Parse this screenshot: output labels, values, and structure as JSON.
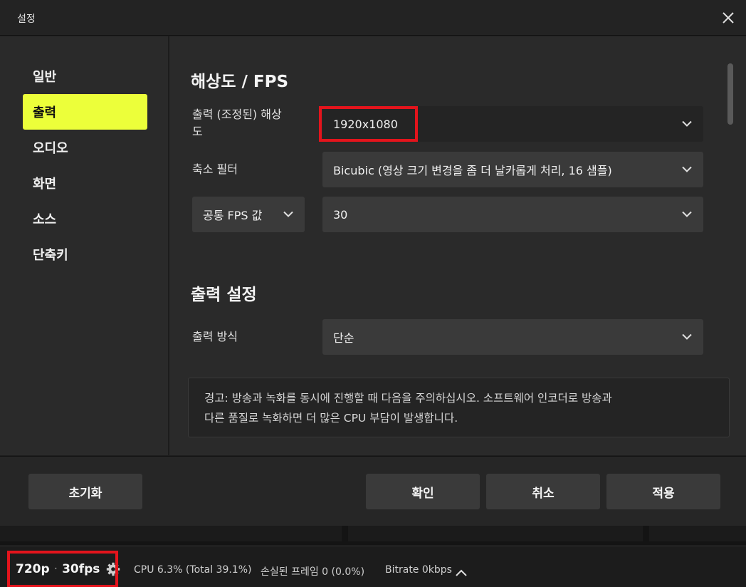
{
  "window": {
    "title": "설정"
  },
  "sidebar": {
    "items": [
      {
        "label": "일반",
        "active": false
      },
      {
        "label": "출력",
        "active": true
      },
      {
        "label": "오디오",
        "active": false
      },
      {
        "label": "화면",
        "active": false
      },
      {
        "label": "소스",
        "active": false
      },
      {
        "label": "단축키",
        "active": false
      }
    ]
  },
  "video": {
    "title": "해상도 / FPS",
    "resolution_label_line1": "출력 (조정된) 해상",
    "resolution_label_line2": "도",
    "resolution_value": "1920x1080",
    "filter_label": "축소 필터",
    "filter_value": "Bicubic (영상 크기 변경을 좀 더 날카롭게 처리, 16 샘플)",
    "fps_type": "공통 FPS 값",
    "fps_value": "30"
  },
  "output": {
    "title": "출력 설정",
    "mode_label": "출력 방식",
    "mode_value": "단순",
    "warning_line1": "경고: 방송과 녹화를 동시에 진행할 때 다음을 주의하십시오. 소프트웨어 인코더로 방송과",
    "warning_line2": "다른 품질로 녹화하면 더 많은 CPU 부담이 발생합니다."
  },
  "buttons": {
    "reset": "초기화",
    "ok": "확인",
    "cancel": "취소",
    "apply": "적용"
  },
  "status": {
    "resolution": "720p",
    "fps": "30fps",
    "cpu": "CPU 6.3% (Total 39.1%)",
    "dropped": "손실된 프레임 0 (0.0%)",
    "bitrate": "Bitrate 0kbps"
  },
  "colors": {
    "accent": "#ecff3a",
    "highlight": "#e3141c"
  },
  "icons": [
    "close-icon",
    "chevron-down-icon",
    "gear-icon",
    "chevron-up-icon"
  ]
}
